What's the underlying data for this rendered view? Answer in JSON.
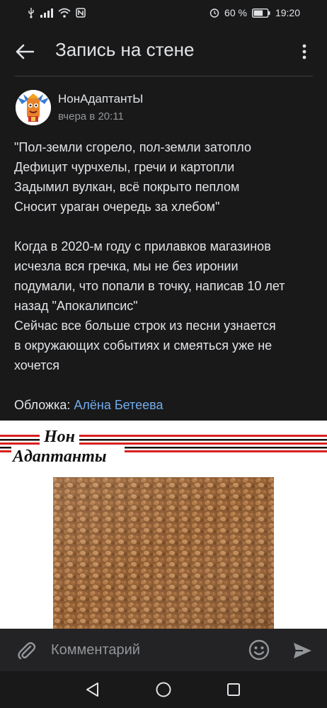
{
  "status_bar": {
    "battery_percent": "60 %",
    "time": "19:20",
    "icons": [
      "usb-icon",
      "signal-icon",
      "wifi-icon",
      "nfc-icon",
      "alarm-icon",
      "battery-icon"
    ]
  },
  "header": {
    "title": "Запись на стене",
    "back_icon": "arrow-left-icon",
    "menu_icon": "more-vertical-icon"
  },
  "post": {
    "author": "НонАдаптантЫ",
    "time": "вчера в 20:11",
    "quote_lines": [
      "\"Пол-земли сгорело, пол-земли затопло",
      "Дефицит чурчхелы, гречи и картопли",
      "Задымил вулкан, всё покрыто пеплом",
      "Сносит ураган очередь за хлебом\""
    ],
    "body_lines": [
      "Когда в 2020-м году с прилавков магазинов",
      "исчезла вся гречка, мы не без иронии",
      "подумали, что попали в точку, написав 10 лет",
      "назад \"Апокалипсис\"",
      "Сейчас все больше строк из песни узнается",
      "в окружающих событиях и смеяться уже не",
      "хочется"
    ],
    "cover_label": "Обложка:",
    "cover_author": "Алёна Бетеева",
    "image": {
      "logo_line1": "Нон",
      "logo_line2": "Адаптанты"
    }
  },
  "comment_bar": {
    "placeholder": "Комментарий",
    "icons": [
      "paperclip-icon",
      "emoji-icon",
      "send-icon"
    ]
  },
  "colors": {
    "background": "#19191a",
    "text": "#e1e3e6",
    "secondary": "#939699",
    "link": "#71aaeb",
    "banner_red": "#d8201f"
  }
}
